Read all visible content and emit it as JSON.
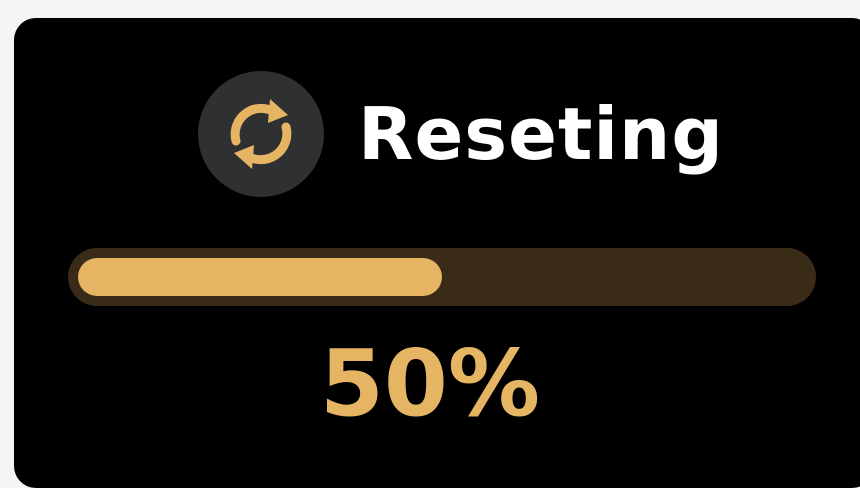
{
  "dialog": {
    "title": "Reseting",
    "icon": "sync-icon",
    "progress": {
      "fraction": 0.5,
      "label": "50%"
    }
  },
  "colors": {
    "background": "#000000",
    "icon_circle": "#2f3032",
    "accent": "#e5b563",
    "track": "#3a2a18",
    "title_text": "#ffffff"
  }
}
